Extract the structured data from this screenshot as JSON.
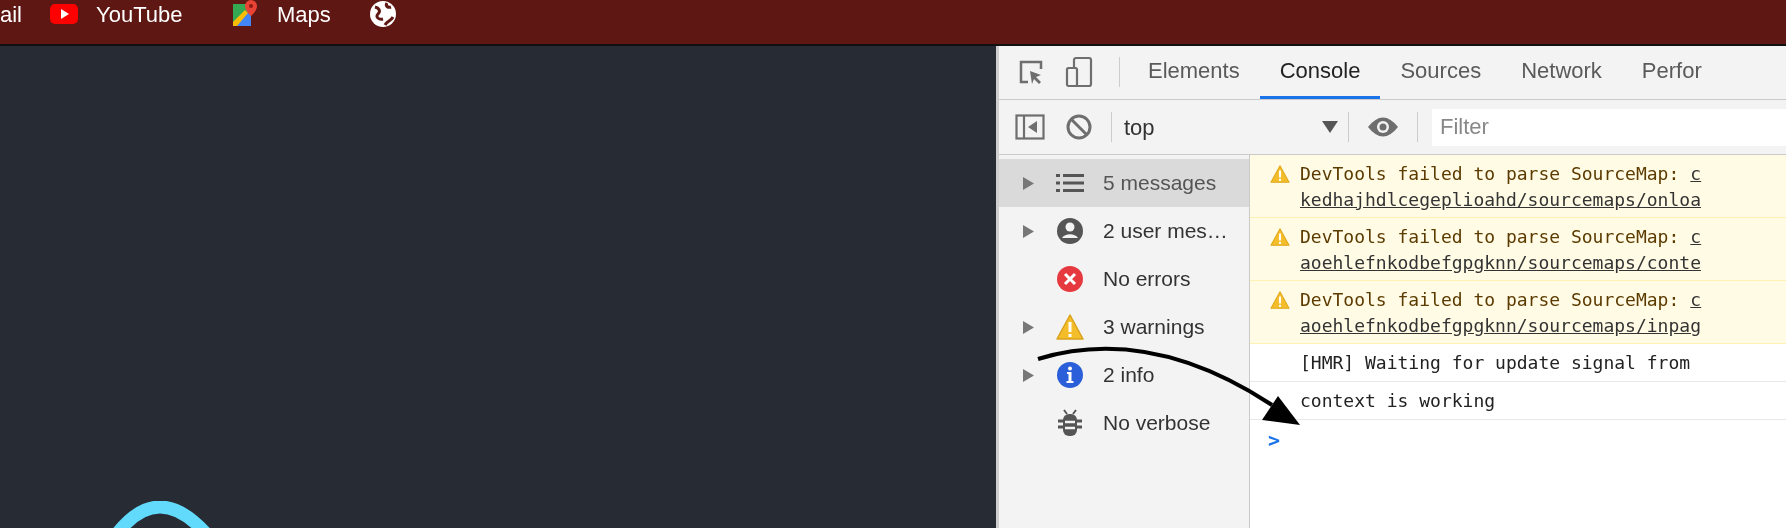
{
  "bookmarks": [
    {
      "kind": "none",
      "label": "ail"
    },
    {
      "kind": "youtube",
      "label": "YouTube"
    },
    {
      "kind": "maps",
      "label": "Maps"
    },
    {
      "kind": "globe"
    }
  ],
  "devtools": {
    "tabs": [
      {
        "label": "Elements",
        "selected": false
      },
      {
        "label": "Console",
        "selected": true
      },
      {
        "label": "Sources",
        "selected": false
      },
      {
        "label": "Network",
        "selected": false
      },
      {
        "label": "Perfor",
        "selected": false
      }
    ],
    "context": "top",
    "filter": {
      "placeholder": "Filter"
    },
    "sidebar": [
      {
        "kind": "list",
        "label": "5 messages",
        "expandable": true,
        "selected": true
      },
      {
        "kind": "user",
        "label": "2 user mes…",
        "expandable": true,
        "selected": false
      },
      {
        "kind": "error",
        "label": "No errors",
        "expandable": false,
        "selected": false
      },
      {
        "kind": "warning",
        "label": "3 warnings",
        "expandable": true,
        "selected": false
      },
      {
        "kind": "info",
        "label": "2 info",
        "expandable": true,
        "selected": false
      },
      {
        "kind": "verbose",
        "label": "No verbose",
        "expandable": false,
        "selected": false
      }
    ],
    "messages": [
      {
        "kind": "warning",
        "text": "DevTools failed to parse SourceMap:",
        "link_start": "c",
        "link_line": "kedhajhdlcegeplioahd/sourcemaps/onloa"
      },
      {
        "kind": "warning",
        "text": "DevTools failed to parse SourceMap:",
        "link_start": "c",
        "link_line": "aoehlefnkodbefgpgknn/sourcemaps/conte"
      },
      {
        "kind": "warning",
        "text": "DevTools failed to parse SourceMap:",
        "link_start": "c",
        "link_line": "aoehlefnkodbefgpgknn/sourcemaps/inpag"
      },
      {
        "kind": "log",
        "text": "[HMR] Waiting for update signal from"
      },
      {
        "kind": "log",
        "text": "context is working"
      }
    ],
    "prompt": ">"
  }
}
